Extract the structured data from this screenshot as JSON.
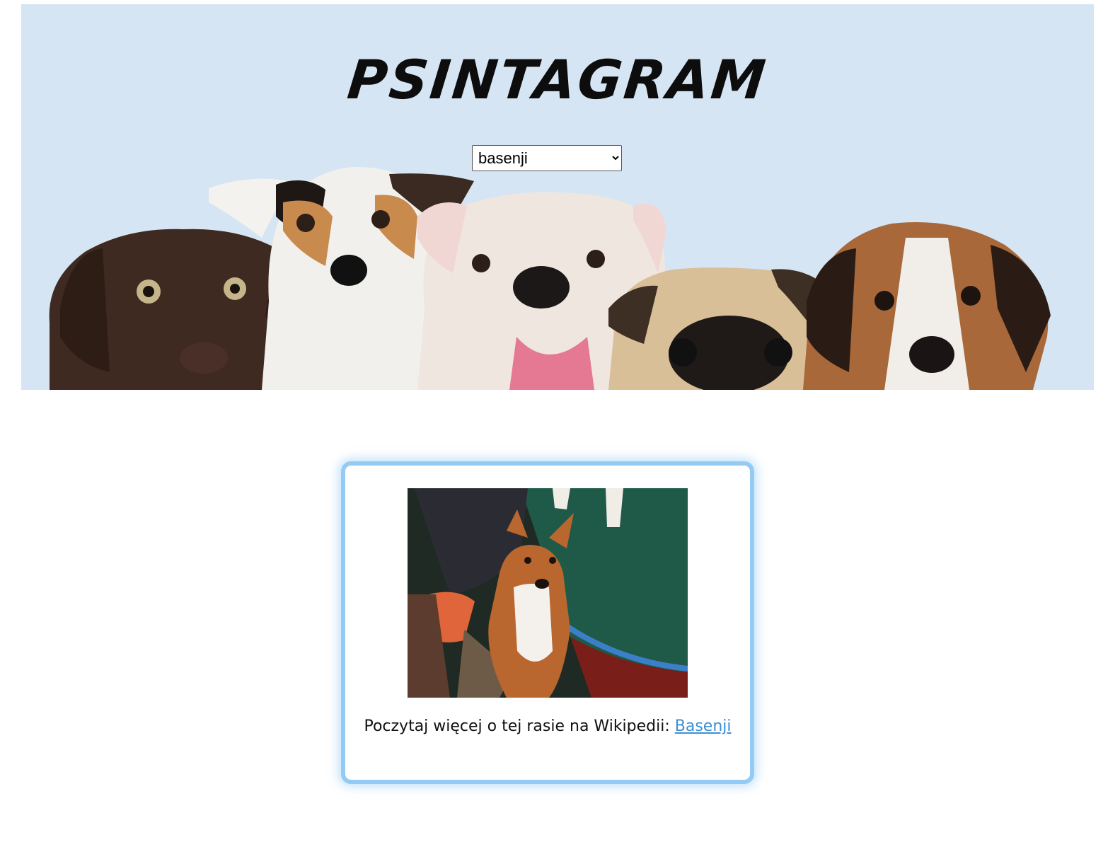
{
  "header": {
    "title": "PSINTAGRAM",
    "background_color": "#d5e5f4",
    "breed_select": {
      "selected": "basenji"
    },
    "banner_image": "puppies-banner"
  },
  "card": {
    "border_color": "#93cbf5",
    "photo": "basenji-dog-photo",
    "caption_text": "Poczytaj więcej o tej rasie na Wikipedii: ",
    "link_label": "Basenji",
    "link_color": "#3c8fd6"
  }
}
